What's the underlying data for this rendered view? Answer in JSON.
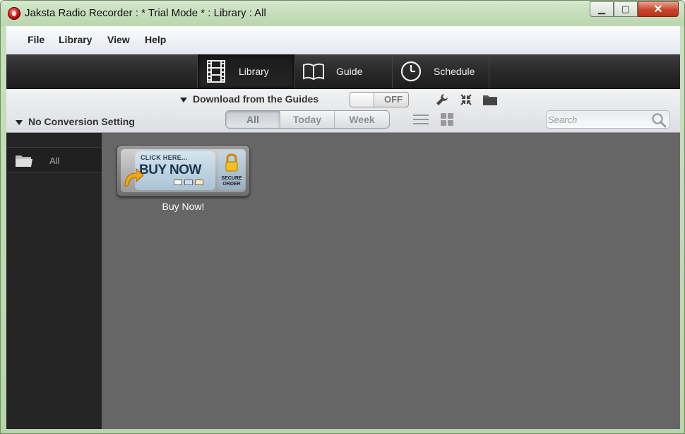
{
  "window": {
    "title": "Jaksta Radio Recorder : * Trial Mode * : Library : All",
    "controls": {
      "minimize": "▁",
      "maximize": "▢",
      "close": "✕"
    }
  },
  "menu": [
    "File",
    "Library",
    "View",
    "Help"
  ],
  "nav_tabs": [
    {
      "label": "Library",
      "icon": "film-icon",
      "active": true
    },
    {
      "label": "Guide",
      "icon": "book-icon",
      "active": false
    },
    {
      "label": "Schedule",
      "icon": "clock-icon",
      "active": false
    }
  ],
  "toolbar": {
    "download_label": "Download from the Guides",
    "toggle_state": "OFF",
    "conversion_label": "No Conversion Setting",
    "filters": [
      "All",
      "Today",
      "Week"
    ],
    "active_filter": "All",
    "search_placeholder": "Search",
    "icons": [
      "wrench-icon",
      "collapse-icon",
      "folder-icon",
      "list-view-icon",
      "grid-view-icon",
      "search-icon"
    ]
  },
  "sidebar": {
    "items": [
      {
        "label": "All",
        "icon": "folder-icon"
      }
    ]
  },
  "content": {
    "items": [
      {
        "caption": "Buy Now!",
        "button_small": "CLICK HERE...",
        "button_big": "BUY NOW",
        "secure_line1": "SECURE",
        "secure_line2": "ORDER"
      }
    ]
  },
  "colors": {
    "titlebar": "#c4dcb8",
    "navbar": "#2b2b2b",
    "content_bg": "#666666",
    "sidebar_bg": "#252525"
  }
}
